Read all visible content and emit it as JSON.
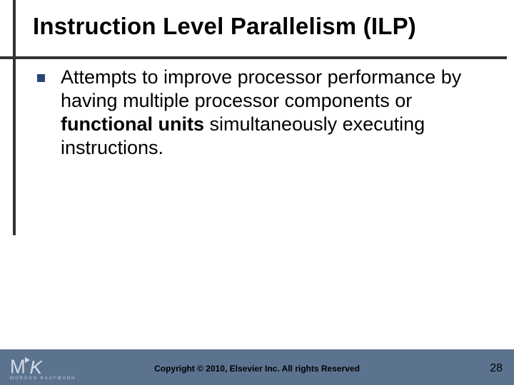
{
  "title": "Instruction Level Parallelism (ILP)",
  "body": {
    "text_before_bold": "Attempts to improve processor performance by having multiple processor components or ",
    "bold_phrase": "functional units",
    "text_after_bold": " simultaneously executing instructions."
  },
  "footer": {
    "logo_letters": {
      "m": "M",
      "k": "K"
    },
    "logo_subtext": "MORGAN KAUFMANN",
    "copyright": "Copyright © 2010, Elsevier Inc. All rights Reserved",
    "page_number": "28"
  }
}
